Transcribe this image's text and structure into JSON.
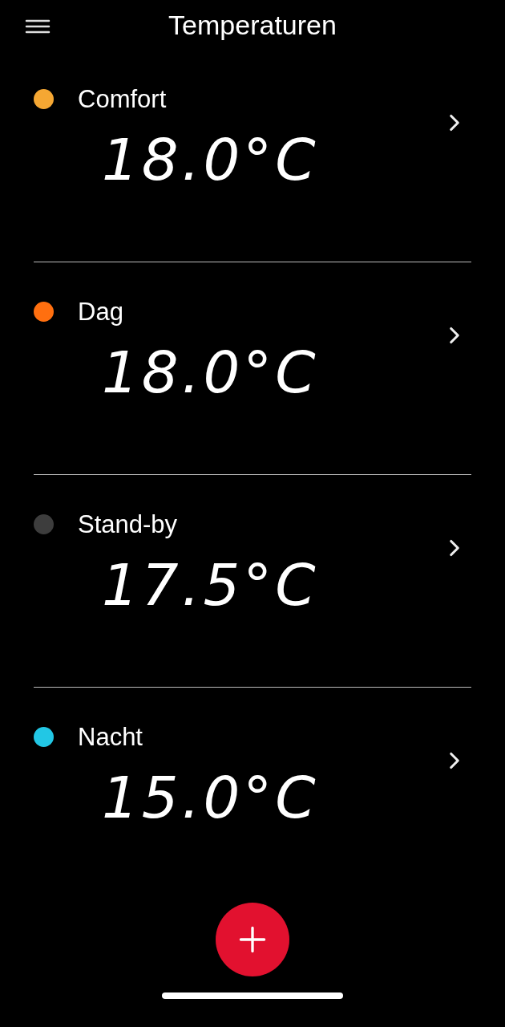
{
  "header": {
    "title": "Temperaturen"
  },
  "presets": [
    {
      "name": "Comfort",
      "temperature": "18.0°C",
      "color": "#f5a733"
    },
    {
      "name": "Dag",
      "temperature": "18.0°C",
      "color": "#ff6f0f"
    },
    {
      "name": "Stand-by",
      "temperature": "17.5°C",
      "color": "#3d3d3d"
    },
    {
      "name": "Nacht",
      "temperature": "15.0°C",
      "color": "#22c7e5"
    }
  ]
}
